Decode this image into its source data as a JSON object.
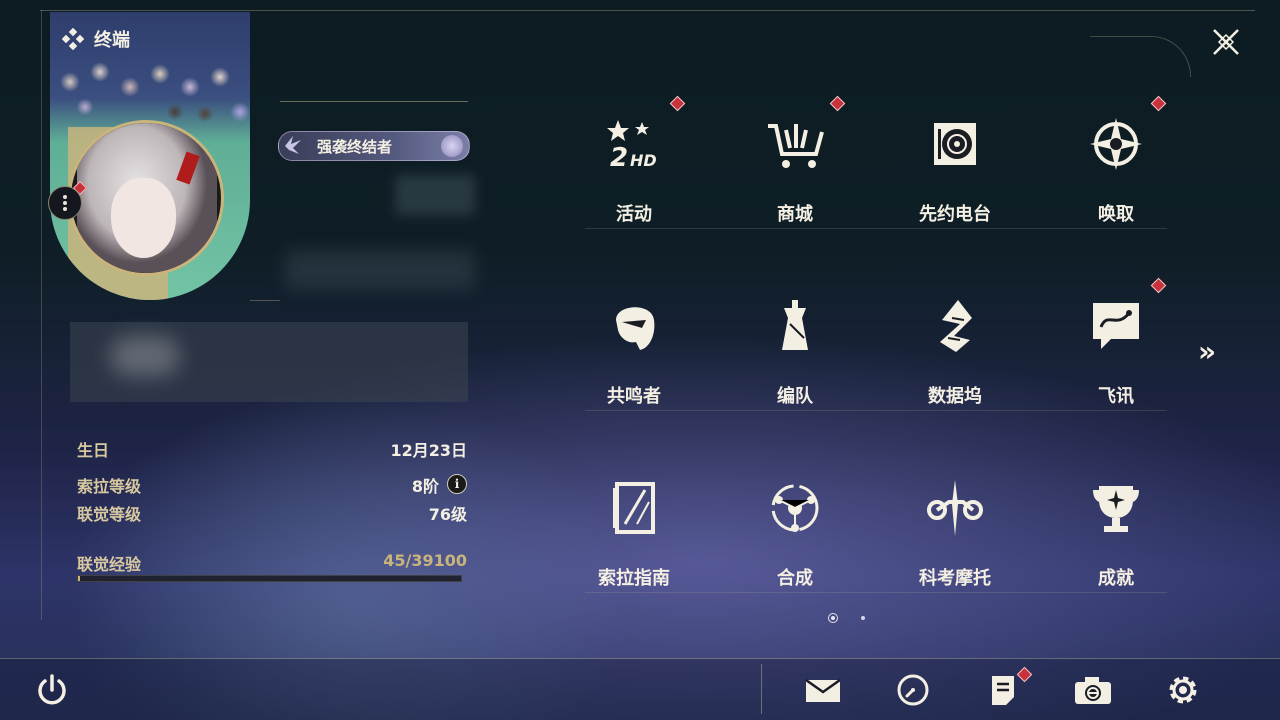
{
  "window": {
    "title": "终端"
  },
  "profile": {
    "title_badge": "强袭终结者",
    "stats": [
      {
        "label": "生日",
        "value": "12月23日"
      },
      {
        "label": "索拉等级",
        "value": "8阶"
      },
      {
        "label": "联觉等级",
        "value": "76级"
      }
    ],
    "exp": {
      "label": "联觉经验",
      "value": "45/39100",
      "progress": 0.0012
    }
  },
  "menu": [
    {
      "label": "活动",
      "icon": "event-2hd-icon",
      "badge": true
    },
    {
      "label": "商城",
      "icon": "shop-cart-icon",
      "badge": true
    },
    {
      "label": "先约电台",
      "icon": "radio-icon",
      "badge": false
    },
    {
      "label": "唤取",
      "icon": "summon-compass-icon",
      "badge": true
    },
    {
      "label": "共鸣者",
      "icon": "resonator-portrait-icon",
      "badge": false
    },
    {
      "label": "编队",
      "icon": "team-chess-icon",
      "badge": false
    },
    {
      "label": "数据坞",
      "icon": "data-bank-icon",
      "badge": false
    },
    {
      "label": "飞讯",
      "icon": "message-chat-icon",
      "badge": true
    },
    {
      "label": "索拉指南",
      "icon": "guidebook-icon",
      "badge": false
    },
    {
      "label": "合成",
      "icon": "synthesis-icon",
      "badge": false
    },
    {
      "label": "科考摩托",
      "icon": "motorbike-icon",
      "badge": false
    },
    {
      "label": "成就",
      "icon": "achievement-trophy-icon",
      "badge": false
    }
  ],
  "colors": {
    "accent_gold": "#c9b47c",
    "badge_red": "#c8323c",
    "text": "#f4efe3"
  }
}
